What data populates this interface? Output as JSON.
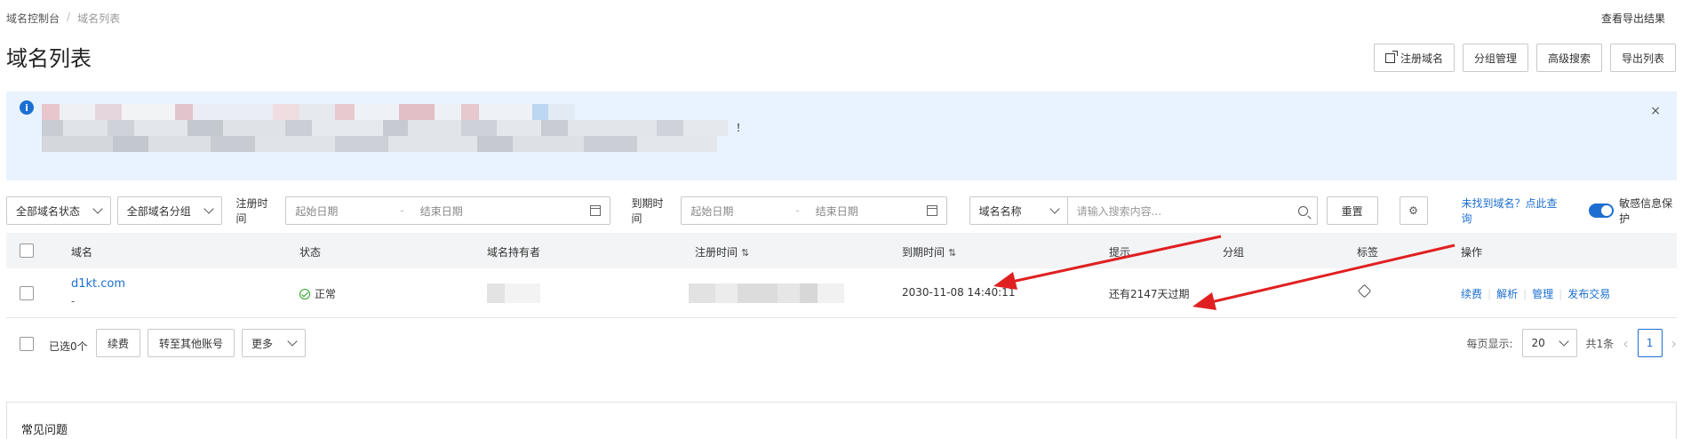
{
  "breadcrumb": {
    "root": "域名控制台",
    "separator": "/",
    "current": "域名列表"
  },
  "header": {
    "export_results_link": "查看导出结果",
    "title": "域名列表"
  },
  "top_actions": {
    "register": "注册域名",
    "group_manage": "分组管理",
    "advanced_search": "高级搜索",
    "export_list": "导出列表"
  },
  "notice": {
    "text_end": "！",
    "close": "×",
    "info": "i"
  },
  "filters": {
    "status_select": "全部域名状态",
    "group_select": "全部域名分组",
    "reg_time_label": "注册时间",
    "reg_start_placeholder": "起始日期",
    "reg_end_placeholder": "结束日期",
    "range_dash": "-",
    "exp_time_label": "到期时间",
    "exp_start_placeholder": "起始日期",
    "exp_end_placeholder": "结束日期",
    "search_field_select": "域名名称",
    "search_placeholder": "请输入搜索内容...",
    "reset_button": "重置",
    "not_found_link": "未找到域名？点此查询",
    "sensitive_toggle_label": "敏感信息保护"
  },
  "table": {
    "columns": {
      "domain": "域名",
      "status": "状态",
      "holder": "域名持有者",
      "reg_time": "注册时间",
      "exp_time": "到期时间",
      "hint": "提示",
      "group": "分组",
      "tag": "标签",
      "actions": "操作"
    },
    "rows": [
      {
        "domain": "d1kt.com",
        "sub": "-",
        "status": "正常",
        "exp_time": "2030-11-08 14:40:11",
        "hint": "还有2147天过期",
        "actions": [
          "续费",
          "解析",
          "管理",
          "发布交易"
        ]
      }
    ]
  },
  "batch": {
    "selected": "已选0个",
    "renew": "续费",
    "transfer": "转至其他账号",
    "more": "更多"
  },
  "pagination": {
    "per_page_label": "每页显示:",
    "per_page_value": "20",
    "total": "共1条",
    "current_page": "1"
  },
  "faq": {
    "title": "常见问题"
  },
  "colors": {
    "accent": "#1c6fd1",
    "notice_bg": "#e9f3ff",
    "annotation_arrow": "#e02020",
    "success": "#2ea121"
  }
}
